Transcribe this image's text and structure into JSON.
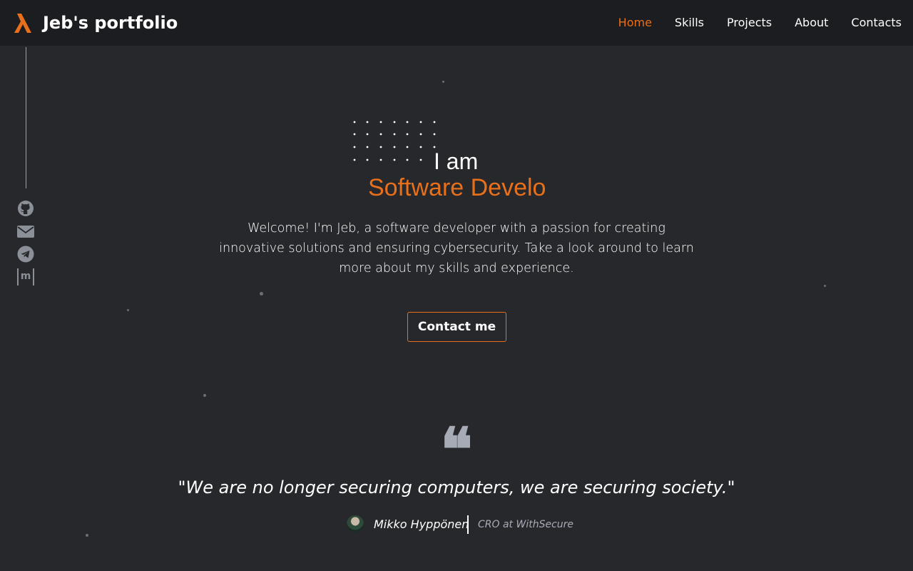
{
  "header": {
    "logo_icon": "lambda-logo-icon",
    "title": "Jeb's portfolio",
    "nav": [
      {
        "label": "Home",
        "active": true
      },
      {
        "label": "Skills",
        "active": false
      },
      {
        "label": "Projects",
        "active": false
      },
      {
        "label": "About",
        "active": false
      },
      {
        "label": "Contacts",
        "active": false
      }
    ]
  },
  "sidebar": {
    "socials": [
      "github-icon",
      "email-icon",
      "telegram-icon",
      "medium-icon"
    ],
    "medium_label": "m"
  },
  "hero": {
    "intro": "I am",
    "role": "Software Develo",
    "description": "Welcome! I'm Jeb, a software developer with a passion for creating innovative solutions and ensuring cybersecurity. Take a look around to learn more about my skills and experience.",
    "cta": "Contact me"
  },
  "quote": {
    "mark": "❝",
    "text": "\"We are no longer securing computers, we are securing society.\"",
    "author": "Mikko Hyppönen",
    "author_role": "CRO at WithSecure"
  },
  "colors": {
    "accent": "#e8701a",
    "background": "#27282c",
    "header": "#1c1d20",
    "muted": "#a6abb5"
  }
}
